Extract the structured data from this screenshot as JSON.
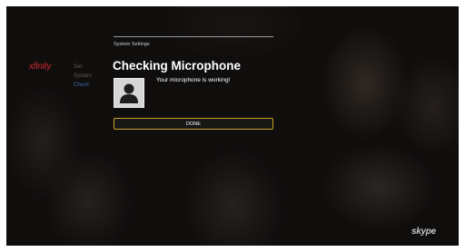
{
  "brand": {
    "logo_text": "xfinity",
    "partner_logo_text": "skype",
    "accent_color": "#d0282e",
    "button_border_color": "#c9a227"
  },
  "background_menu": {
    "items": [
      "Set",
      "System",
      "Check"
    ],
    "active_index": 2
  },
  "dialog": {
    "section_label": "System Settings",
    "title": "Checking Microphone",
    "icon": "person-silhouette-icon",
    "message": "Your microphone is working!",
    "done_label": "DONE"
  }
}
